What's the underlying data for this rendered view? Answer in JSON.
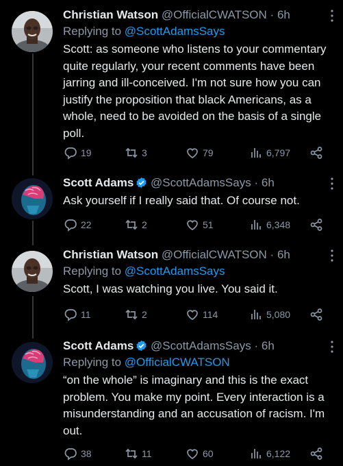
{
  "tweets": [
    {
      "name": "Christian Watson",
      "handle": "@OfficialCWATSON",
      "time": "6h",
      "verified": false,
      "replying_prefix": "Replying to",
      "replying_to": "@ScottAdamsSays",
      "text": "Scott: as someone who listens to your commentary quite regularly, your recent comments have been jarring and ill-conceived. I'm not sure how you can justify the proposition that black Americans, as a whole, need to be avoided on the basis of a single poll.",
      "replies": "19",
      "retweets": "3",
      "likes": "79",
      "views": "6,797"
    },
    {
      "name": "Scott Adams",
      "handle": "@ScottAdamsSays",
      "time": "6h",
      "verified": true,
      "replying_prefix": "",
      "replying_to": "",
      "text": "Ask yourself if I really said that. Of course not.",
      "replies": "22",
      "retweets": "2",
      "likes": "51",
      "views": "6,348"
    },
    {
      "name": "Christian Watson",
      "handle": "@OfficialCWATSON",
      "time": "6h",
      "verified": false,
      "replying_prefix": "Replying to",
      "replying_to": "@ScottAdamsSays",
      "text": "Scott, I was watching you live. You said it.",
      "replies": "11",
      "retweets": "2",
      "likes": "114",
      "views": "5,080"
    },
    {
      "name": "Scott Adams",
      "handle": "@ScottAdamsSays",
      "time": "6h",
      "verified": true,
      "replying_prefix": "Replying to",
      "replying_to": "@OfficialCWATSON",
      "text": "“on the whole” is imaginary and this is the exact problem. You make my point. Every interaction is a misunderstanding and an accusation of racism. I'm out.",
      "replies": "38",
      "retweets": "11",
      "likes": "60",
      "views": "6,122"
    }
  ],
  "colors": {
    "background": "#000000",
    "text": "#e7e9ea",
    "muted": "#8b98a5",
    "accent": "#1d9bf0"
  },
  "separator": "·"
}
